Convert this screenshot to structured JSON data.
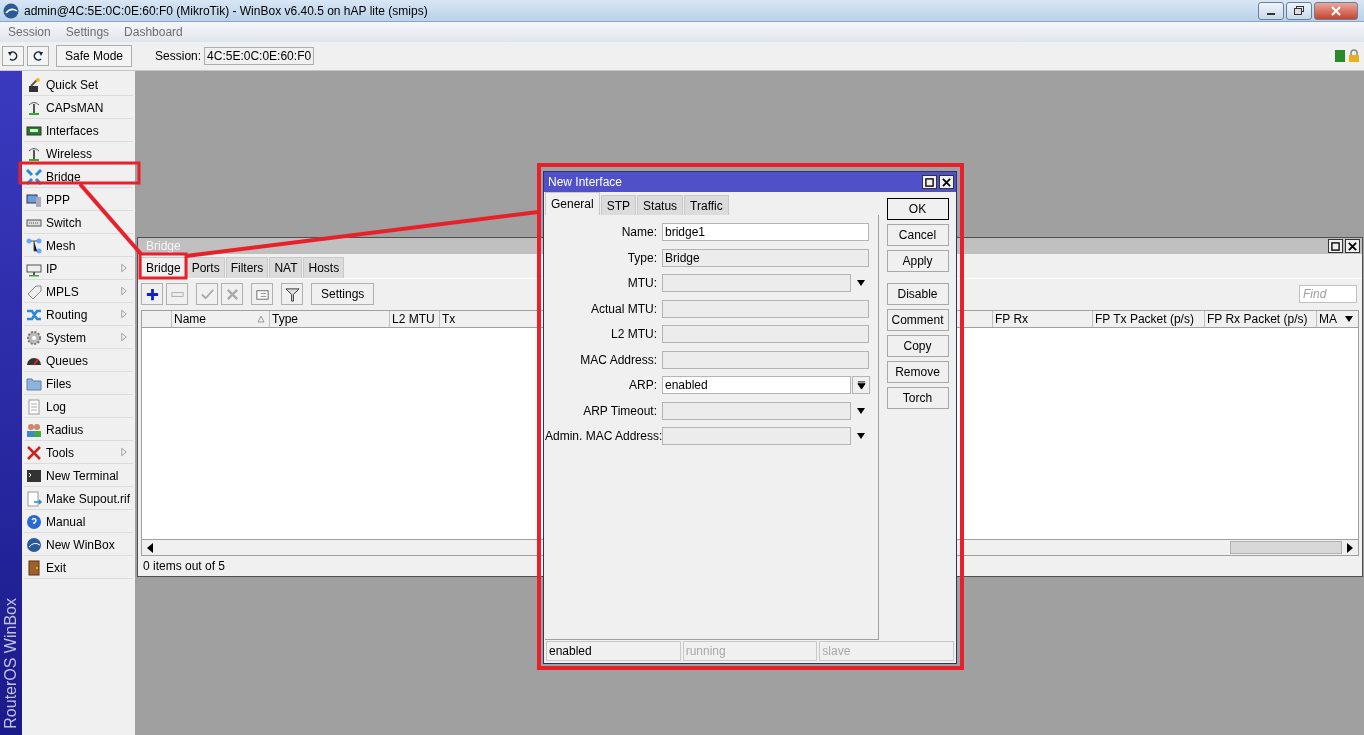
{
  "window": {
    "title": "admin@4C:5E:0C:0E:60:F0 (MikroTik) - WinBox v6.40.5 on hAP lite (smips)"
  },
  "menu": [
    "Session",
    "Settings",
    "Dashboard"
  ],
  "toolbar": {
    "safe_mode": "Safe Mode",
    "session_label": "Session:",
    "session_value": "4C:5E:0C:0E:60:F0"
  },
  "sidebar": {
    "brand": "RouterOS WinBox",
    "items": [
      {
        "label": "Quick Set",
        "has_submenu": false
      },
      {
        "label": "CAPsMAN",
        "has_submenu": false
      },
      {
        "label": "Interfaces",
        "has_submenu": false
      },
      {
        "label": "Wireless",
        "has_submenu": false
      },
      {
        "label": "Bridge",
        "has_submenu": false
      },
      {
        "label": "PPP",
        "has_submenu": false
      },
      {
        "label": "Switch",
        "has_submenu": false
      },
      {
        "label": "Mesh",
        "has_submenu": false
      },
      {
        "label": "IP",
        "has_submenu": true
      },
      {
        "label": "MPLS",
        "has_submenu": true
      },
      {
        "label": "Routing",
        "has_submenu": true
      },
      {
        "label": "System",
        "has_submenu": true
      },
      {
        "label": "Queues",
        "has_submenu": false
      },
      {
        "label": "Files",
        "has_submenu": false
      },
      {
        "label": "Log",
        "has_submenu": false
      },
      {
        "label": "Radius",
        "has_submenu": false
      },
      {
        "label": "Tools",
        "has_submenu": true
      },
      {
        "label": "New Terminal",
        "has_submenu": false
      },
      {
        "label": "Make Supout.rif",
        "has_submenu": false
      },
      {
        "label": "Manual",
        "has_submenu": false
      },
      {
        "label": "New WinBox",
        "has_submenu": false
      },
      {
        "label": "Exit",
        "has_submenu": false
      }
    ]
  },
  "bridge_window": {
    "title": "Bridge",
    "tabs": [
      {
        "label": "Bridge",
        "selected": true
      },
      {
        "label": "Ports",
        "selected": false
      },
      {
        "label": "Filters",
        "selected": false
      },
      {
        "label": "NAT",
        "selected": false
      },
      {
        "label": "Hosts",
        "selected": false
      }
    ],
    "settings_button": "Settings",
    "find": {
      "placeholder": "Find"
    },
    "columns_left": [
      {
        "label": "Name",
        "sorted": true
      },
      {
        "label": "Type",
        "sorted": false
      },
      {
        "label": "L2 MTU",
        "sorted": false
      },
      {
        "label": "Tx",
        "sorted": false
      }
    ],
    "columns_right": [
      {
        "label": "FP Rx"
      },
      {
        "label": "FP Tx Packet (p/s)"
      },
      {
        "label": "FP Rx Packet (p/s)"
      },
      {
        "label": "MA"
      }
    ],
    "status": "0 items out of 5"
  },
  "dialog": {
    "title": "New Interface",
    "tabs": [
      {
        "label": "General",
        "selected": true
      },
      {
        "label": "STP",
        "selected": false
      },
      {
        "label": "Status",
        "selected": false
      },
      {
        "label": "Traffic",
        "selected": false
      }
    ],
    "fields": [
      {
        "label": "Name:",
        "kind": "text",
        "value": "bridge1"
      },
      {
        "label": "Type:",
        "kind": "readonly",
        "value": "Bridge"
      },
      {
        "label": "MTU:",
        "kind": "dropdown"
      },
      {
        "label": "Actual MTU:",
        "kind": "readonly"
      },
      {
        "label": "L2 MTU:",
        "kind": "readonly"
      },
      {
        "label": "MAC Address:",
        "kind": "readonly"
      },
      {
        "label": "ARP:",
        "kind": "combo",
        "value": "enabled"
      },
      {
        "label": "ARP Timeout:",
        "kind": "dropdown"
      },
      {
        "label": "Admin. MAC Address:",
        "kind": "dropdown"
      }
    ],
    "button_groups": [
      [
        {
          "label": "OK",
          "default": true
        },
        {
          "label": "Cancel",
          "default": false
        },
        {
          "label": "Apply",
          "default": false
        }
      ],
      [
        {
          "label": "Disable",
          "default": false
        },
        {
          "label": "Comment",
          "default": false
        },
        {
          "label": "Copy",
          "default": false
        },
        {
          "label": "Remove",
          "default": false
        },
        {
          "label": "Torch",
          "default": false
        }
      ]
    ],
    "status": [
      {
        "text": "enabled",
        "active": true
      },
      {
        "text": "running",
        "active": false
      },
      {
        "text": "slave",
        "active": false
      }
    ]
  }
}
